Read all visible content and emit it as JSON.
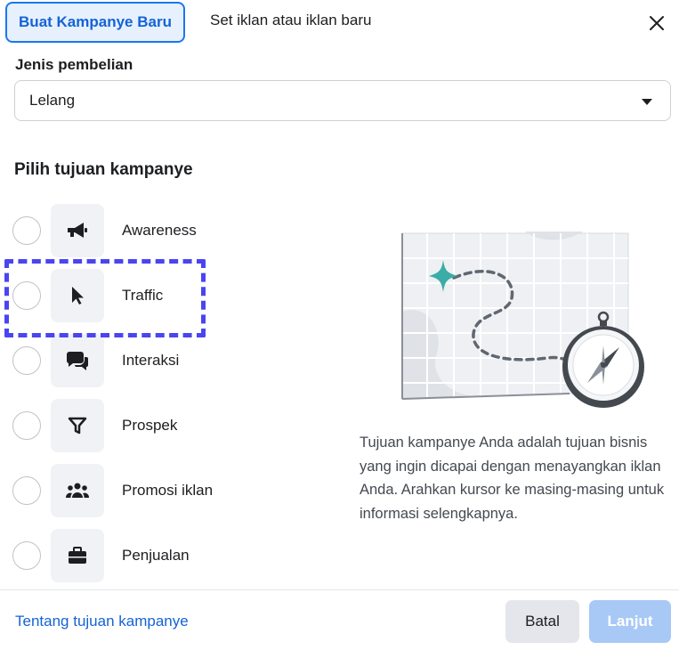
{
  "tabs": {
    "active": "Buat Kampanye Baru",
    "inactive": "Set iklan atau iklan baru"
  },
  "purchase_type": {
    "label": "Jenis pembelian",
    "selected": "Lelang"
  },
  "objective_section": {
    "heading": "Pilih tujuan kampanye",
    "objectives": [
      {
        "label": "Awareness",
        "icon": "megaphone-icon"
      },
      {
        "label": "Traffic",
        "icon": "cursor-icon"
      },
      {
        "label": "Interaksi",
        "icon": "chat-bubbles-icon"
      },
      {
        "label": "Prospek",
        "icon": "funnel-icon"
      },
      {
        "label": "Promosi iklan",
        "icon": "people-group-icon"
      },
      {
        "label": "Penjualan",
        "icon": "briefcase-icon"
      }
    ],
    "highlighted": "Traffic",
    "description": "Tujuan kampanye Anda adalah tujuan bisnis yang ingin dicapai dengan menayangkan iklan Anda. Arahkan kursor ke masing-masing untuk informasi selengkapnya."
  },
  "footer": {
    "link": "Tentang tujuan kampanye",
    "cancel": "Batal",
    "next": "Lanjut"
  },
  "colors": {
    "accent": "#1877f2",
    "highlight_dash": "#4a45f0",
    "teal_star": "#3bada6"
  }
}
